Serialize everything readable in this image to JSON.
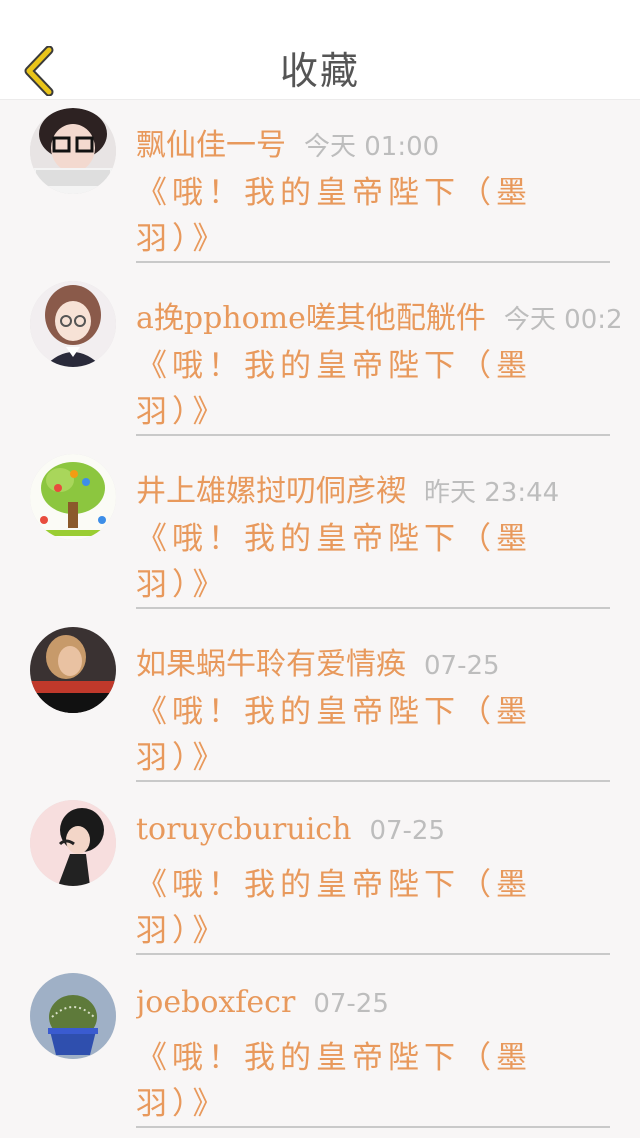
{
  "header": {
    "title": "收藏",
    "back_icon": "chevron-left-icon",
    "accent": "#e9c41a"
  },
  "colors": {
    "username": "#e8995c",
    "message": "#e8995c",
    "time": "#bdbdbd"
  },
  "items": [
    {
      "username": "飘仙佳一号",
      "time": "今天 01:00",
      "message": "《哦！我的皇帝陛下（墨羽）》",
      "avatar": "avatar-girl-glasses-icon"
    },
    {
      "username": "a挽pphome嗟其他配觥件",
      "time": "今天 00:2",
      "message": "《哦！我的皇帝陛下（墨羽）》",
      "avatar": "avatar-anime-girl-icon"
    },
    {
      "username": "井上雄嫘挝叨侗彦褉",
      "time": "昨天 23:44",
      "message": "《哦！我的皇帝陛下（墨羽）》",
      "avatar": "avatar-family-tree-icon"
    },
    {
      "username": "如果蜗牛聆有爱情痪",
      "time": "07-25",
      "message": "《哦！我的皇帝陛下（墨羽）》",
      "avatar": "avatar-woman-photo-icon"
    },
    {
      "username": "toruycburuich",
      "time": "07-25",
      "message": "《哦！我的皇帝陛下（墨羽）》",
      "avatar": "avatar-anime-boy-icon"
    },
    {
      "username": "joeboxfecr",
      "time": "07-25",
      "message": "《哦！我的皇帝陛下（墨羽）》",
      "avatar": "avatar-cactus-icon"
    }
  ]
}
